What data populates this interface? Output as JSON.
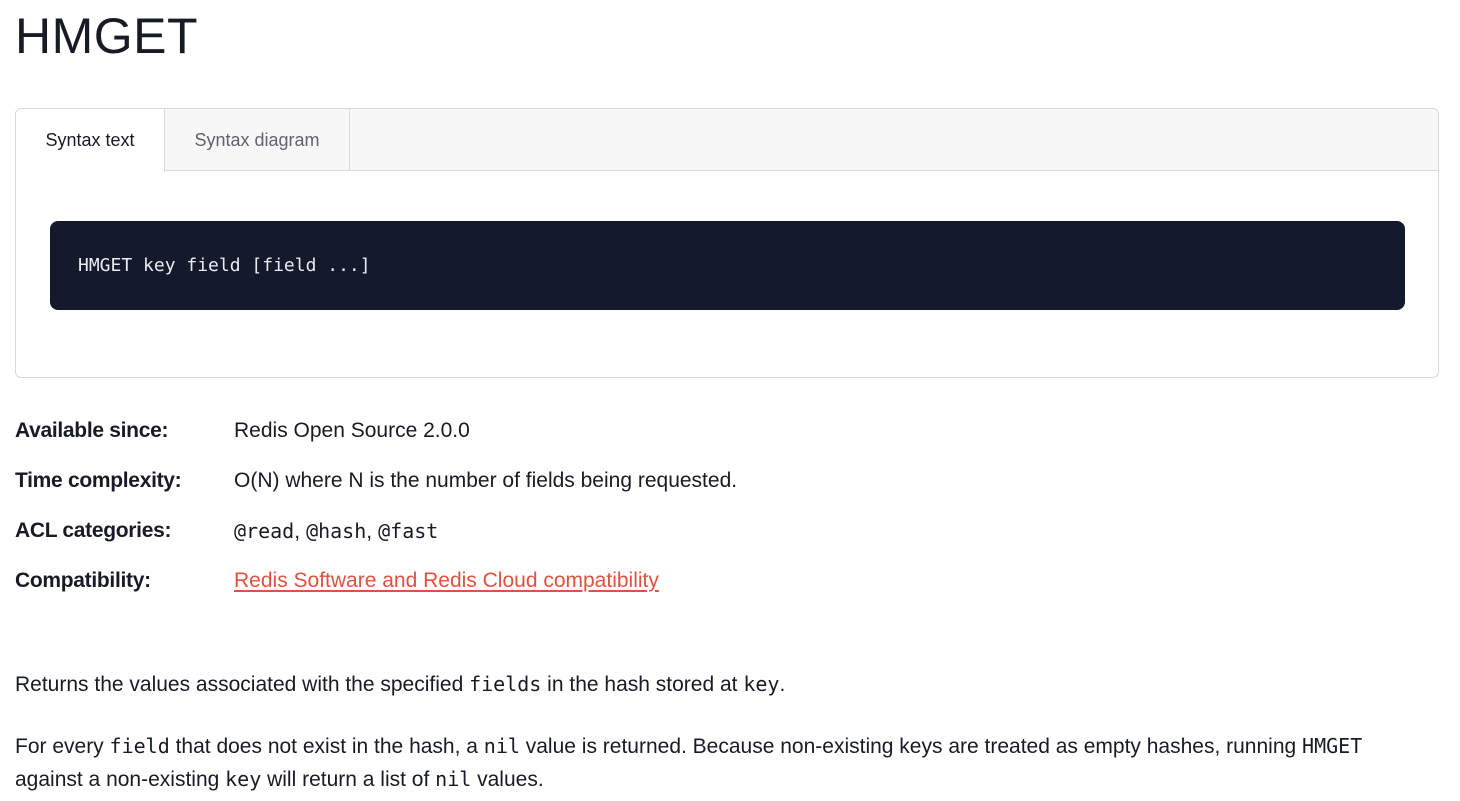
{
  "page": {
    "title": "HMGET"
  },
  "tabs": [
    {
      "label": "Syntax text",
      "active": true
    },
    {
      "label": "Syntax diagram",
      "active": false
    }
  ],
  "syntax": {
    "code": "HMGET key field [field ...]"
  },
  "meta": {
    "available_since": {
      "label": "Available since:",
      "value": "Redis Open Source 2.0.0"
    },
    "time_complexity": {
      "label": "Time complexity:",
      "value": "O(N) where N is the number of fields being requested."
    },
    "acl_categories": {
      "label": "ACL categories:",
      "values": [
        "@read",
        "@hash",
        "@fast"
      ],
      "separator": ","
    },
    "compatibility": {
      "label": "Compatibility:",
      "link_text": "Redis Software and Redis Cloud compatibility"
    }
  },
  "description": {
    "p1": {
      "t1": "Returns the values associated with the specified ",
      "c1": "fields",
      "t2": " in the hash stored at ",
      "c2": "key",
      "t3": "."
    },
    "p2": {
      "t1": "For every ",
      "c1": "field",
      "t2": " that does not exist in the hash, a ",
      "c2": "nil",
      "t3": " value is returned. Because non-existing keys are treated as empty hashes, running ",
      "c3": "HMGET",
      "t4": " against a non-existing ",
      "c4": "key",
      "t5": " will return a list of ",
      "c5": "nil",
      "t6": " values."
    }
  },
  "colors": {
    "text": "#161b26",
    "code_bg": "#141a2b",
    "link": "#e2513f",
    "border": "#d5d8de",
    "tab_bar_bg": "#f7f7f8"
  }
}
